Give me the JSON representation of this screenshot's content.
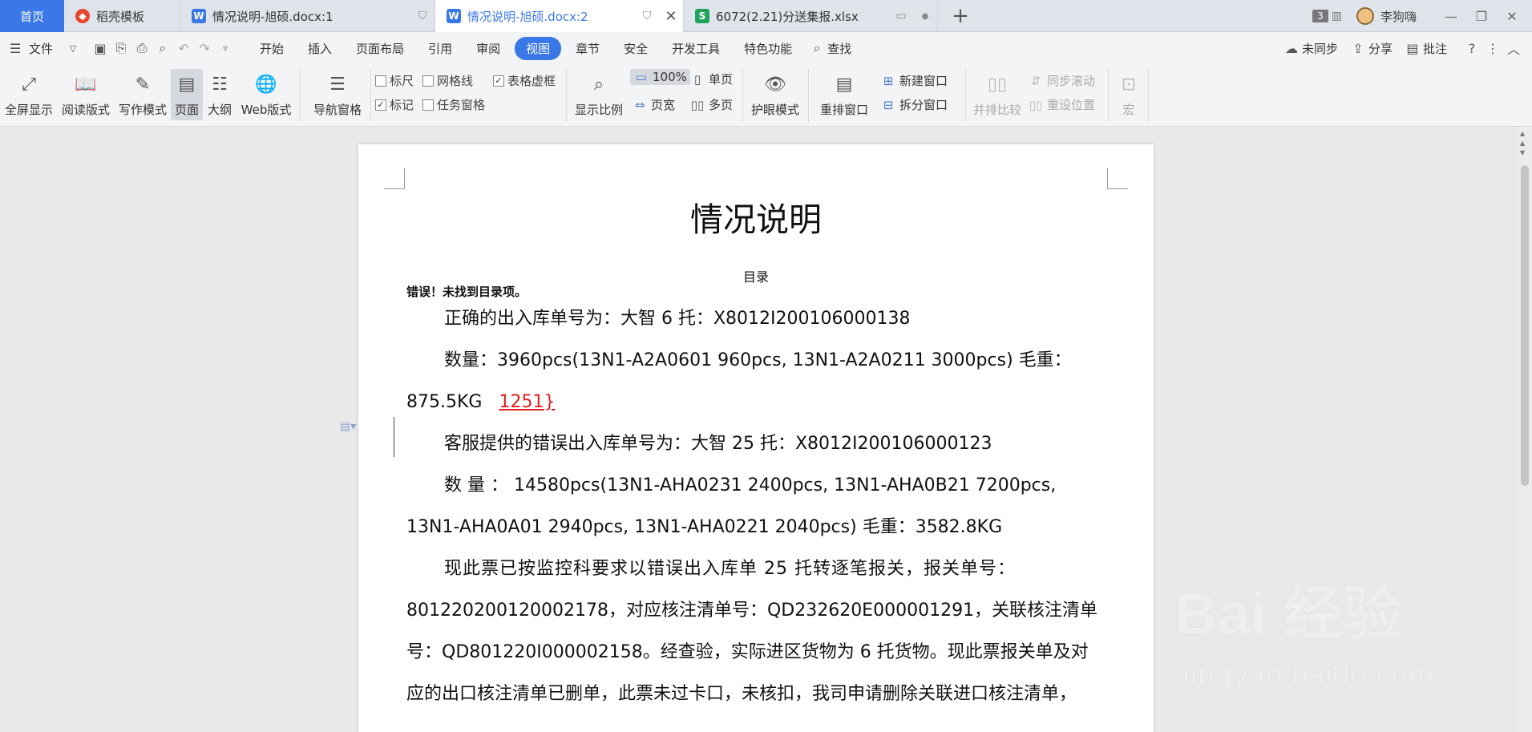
{
  "tabs": {
    "home": "首页",
    "daoke": "稻壳模板",
    "doc1": "情况说明-旭硕.docx:1",
    "doc2": "情况说明-旭硕.docx:2",
    "xlsx": "6072(2.21)分送集报.xlsx",
    "window_count": "3",
    "user_name": "李狗嗨"
  },
  "menu": {
    "file": "文件",
    "items": [
      "开始",
      "插入",
      "页面布局",
      "引用",
      "审阅",
      "视图",
      "章节",
      "安全",
      "开发工具",
      "特色功能"
    ],
    "search": "查找",
    "sync": "未同步",
    "share": "分享",
    "comment": "批注"
  },
  "ribbon": {
    "fullscreen": "全屏显示",
    "reading": "阅读版式",
    "writing": "写作模式",
    "page": "页面",
    "outline": "大纲",
    "web": "Web版式",
    "nav_pane": "导航窗格",
    "ruler": "标尺",
    "gridlines": "网格线",
    "table_gridlines": "表格虚框",
    "marks": "标记",
    "task_pane": "任务窗格",
    "zoom": "显示比例",
    "zoom_100": "100%",
    "page_width": "页宽",
    "single_page": "单页",
    "multi_page": "多页",
    "eye_care": "护眼模式",
    "rearrange": "重排窗口",
    "new_window": "新建窗口",
    "split_window": "拆分窗口",
    "side_by_side": "并排比较",
    "sync_scroll": "同步滚动",
    "reset_position": "重设位置",
    "macro": "宏"
  },
  "document": {
    "title": "情况说明",
    "toc_title": "目录",
    "toc_error": "错误！未找到目录项。",
    "p1": "正确的出入库单号为：大智 6 托：X8012I200106000138",
    "p2": "数量：3960pcs(13N1-A2A0601 960pcs, 13N1-A2A0211 3000pcs)   毛重：",
    "p3_weight": "875.5KG",
    "p3_red": "1251}",
    "p4": "客服提供的错误出入库单号为：大智 25 托：X8012I200106000123",
    "p5": "数 量 ： 14580pcs(13N1-AHA0231  2400pcs,  13N1-AHA0B21  7200pcs,",
    "p6": "13N1-AHA0A01 2940pcs, 13N1-AHA0221 2040pcs)     毛重：3582.8KG",
    "p7": "现此票已按监控科要求以错误出入库单 25 托转逐笔报关，报关单号：",
    "p8": "801220200120002178，对应核注清单号：QD232620E000001291，关联核注清单",
    "p9": "号：QD801220I000002158。经查验，实际进区货物为 6 托货物。现此票报关单及对",
    "p10": "应的出口核注清单已删单，此票未过卡口，未核扣，我司申请删除关联进口核注清单，"
  },
  "watermark": {
    "brand": "Bai 经验",
    "url": "jingyan.baidu.com"
  }
}
